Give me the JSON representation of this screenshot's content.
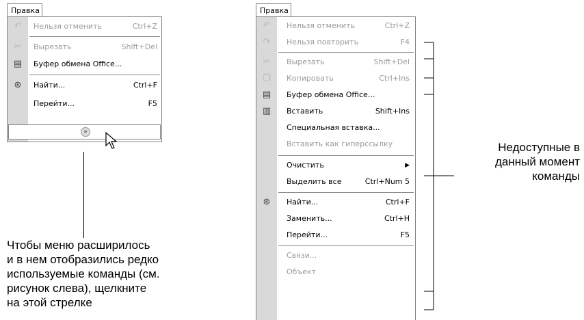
{
  "left_menu": {
    "title": "Правка",
    "items": [
      {
        "label": "Нельзя отменить",
        "shortcut": "Ctrl+Z",
        "icon": "undo-icon",
        "disabled": true
      },
      {
        "label": "Вырезать",
        "shortcut": "Shift+Del",
        "icon": "scissors-icon",
        "disabled": true
      },
      {
        "label": "Буфер обмена Office...",
        "shortcut": "",
        "icon": "clipboard-office-icon",
        "disabled": false
      },
      {
        "label": "Найти...",
        "shortcut": "Ctrl+F",
        "icon": "binoculars-icon",
        "disabled": false
      },
      {
        "label": "Перейти...",
        "shortcut": "F5",
        "icon": "",
        "disabled": false
      }
    ],
    "expand_icon": "double-chevron-down-icon"
  },
  "right_menu": {
    "title": "Правка",
    "items": [
      {
        "label": "Нельзя отменить",
        "shortcut": "Ctrl+Z",
        "icon": "undo-icon",
        "disabled": true
      },
      {
        "label": "Нельзя повторить",
        "shortcut": "F4",
        "icon": "redo-icon",
        "disabled": true
      },
      {
        "label": "Вырезать",
        "shortcut": "Shift+Del",
        "icon": "scissors-icon",
        "disabled": true
      },
      {
        "label": "Копировать",
        "shortcut": "Ctrl+Ins",
        "icon": "copy-icon",
        "disabled": true
      },
      {
        "label": "Буфер обмена Office...",
        "shortcut": "",
        "icon": "clipboard-office-icon",
        "disabled": false
      },
      {
        "label": "Вставить",
        "shortcut": "Shift+Ins",
        "icon": "paste-icon",
        "disabled": false
      },
      {
        "label": "Специальная вставка...",
        "shortcut": "",
        "icon": "",
        "disabled": false
      },
      {
        "label": "Вставить как гиперссылку",
        "shortcut": "",
        "icon": "",
        "disabled": true
      },
      {
        "label": "Очистить",
        "shortcut": "",
        "icon": "",
        "disabled": false,
        "submenu": true
      },
      {
        "label": "Выделить все",
        "shortcut": "Ctrl+Num 5",
        "icon": "",
        "disabled": false
      },
      {
        "label": "Найти...",
        "shortcut": "Ctrl+F",
        "icon": "binoculars-icon",
        "disabled": false
      },
      {
        "label": "Заменить...",
        "shortcut": "Ctrl+H",
        "icon": "",
        "disabled": false
      },
      {
        "label": "Перейти...",
        "shortcut": "F5",
        "icon": "",
        "disabled": false
      },
      {
        "label": "Связи...",
        "shortcut": "",
        "icon": "",
        "disabled": true
      },
      {
        "label": "Объект",
        "shortcut": "",
        "icon": "",
        "disabled": true
      }
    ],
    "submenu_arrow_icon": "triangle-right-icon"
  },
  "annotations": {
    "unavailable": [
      "Недоступные в",
      "данный момент",
      "команды"
    ],
    "expand_hint": [
      "Чтобы меню расширилось",
      "и в нем отобразились редко",
      "используемые команды (см.",
      "рисунок слева), щелкните",
      "на этой стрелке"
    ]
  },
  "icons": {
    "cursor": "mouse-pointer-icon",
    "bracket": "bracket-tick-icon"
  }
}
